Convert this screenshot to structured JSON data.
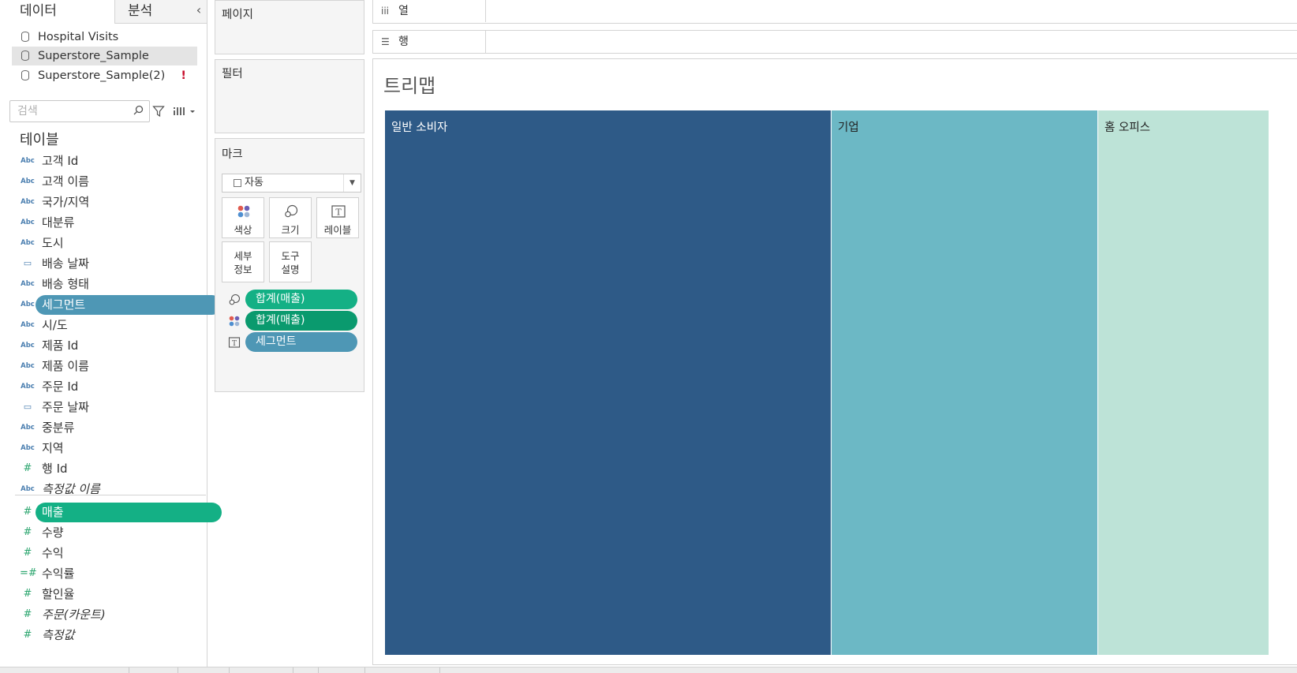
{
  "left_pane": {
    "tabs": {
      "data": "데이터",
      "analysis": "분석"
    },
    "collapse_icon": "chevron-left-icon",
    "data_sources": [
      {
        "name": "Hospital Visits",
        "selected": false,
        "warning": ""
      },
      {
        "name": "Superstore_Sample",
        "selected": true,
        "warning": ""
      },
      {
        "name": "Superstore_Sample(2)",
        "selected": false,
        "warning": "!"
      }
    ],
    "search": {
      "placeholder": "검색",
      "value": ""
    },
    "tables_header": "테이블",
    "fields": [
      {
        "type": "Abc",
        "kind": "dim",
        "label": "고객 Id"
      },
      {
        "type": "Abc",
        "kind": "dim",
        "label": "고객 이름"
      },
      {
        "type": "Abc",
        "kind": "dim",
        "label": "국가/지역"
      },
      {
        "type": "Abc",
        "kind": "dim",
        "label": "대분류"
      },
      {
        "type": "Abc",
        "kind": "dim",
        "label": "도시"
      },
      {
        "type": "date",
        "kind": "dim",
        "label": "배송 날짜"
      },
      {
        "type": "Abc",
        "kind": "dim",
        "label": "배송 형태"
      },
      {
        "type": "Abc",
        "kind": "dim",
        "label": "세그먼트",
        "pill": "dim"
      },
      {
        "type": "Abc",
        "kind": "dim",
        "label": "시/도"
      },
      {
        "type": "Abc",
        "kind": "dim",
        "label": "제품 Id"
      },
      {
        "type": "Abc",
        "kind": "dim",
        "label": "제품 이름"
      },
      {
        "type": "Abc",
        "kind": "dim",
        "label": "주문 Id"
      },
      {
        "type": "date",
        "kind": "dim",
        "label": "주문 날짜"
      },
      {
        "type": "Abc",
        "kind": "dim",
        "label": "중분류"
      },
      {
        "type": "Abc",
        "kind": "dim",
        "label": "지역"
      },
      {
        "type": "#",
        "kind": "dim",
        "label": "행 Id"
      },
      {
        "type": "Abc",
        "kind": "dim",
        "label": "측정값 이름",
        "italic": true
      },
      {
        "type": "#",
        "kind": "meas",
        "label": "매출",
        "pill": "meas"
      },
      {
        "type": "#",
        "kind": "meas",
        "label": "수량"
      },
      {
        "type": "#",
        "kind": "meas",
        "label": "수익"
      },
      {
        "type": "=#",
        "kind": "meas",
        "label": "수익률"
      },
      {
        "type": "#",
        "kind": "meas",
        "label": "할인율"
      },
      {
        "type": "#",
        "kind": "meas",
        "label": "주문(카운트)",
        "italic": true
      },
      {
        "type": "#",
        "kind": "meas",
        "label": "측정값",
        "italic": true
      }
    ]
  },
  "shelves": {
    "pages": "페이지",
    "filters": "필터",
    "marks": {
      "title": "마크",
      "mark_type": "자동",
      "buttons": [
        {
          "id": "color",
          "label": "색상",
          "icon": "color-dots-icon"
        },
        {
          "id": "size",
          "label": "크기",
          "icon": "size-icon"
        },
        {
          "id": "label",
          "label": "레이블",
          "icon": "text-label-icon"
        },
        {
          "id": "detail",
          "label": "세부\n정보",
          "icon": ""
        },
        {
          "id": "tooltip",
          "label": "도구\n설명",
          "icon": ""
        }
      ],
      "pills": [
        {
          "icon": "size-icon",
          "label": "합계(매출)",
          "style": "meas"
        },
        {
          "icon": "color-dots-icon",
          "label": "합계(매출)",
          "style": "meas-dark"
        },
        {
          "icon": "text-label-icon",
          "label": "세그먼트",
          "style": "dim"
        }
      ]
    }
  },
  "view": {
    "columns_label": "열",
    "rows_label": "행",
    "title": "트리맵"
  },
  "chart_data": {
    "type": "treemap",
    "title": "트리맵",
    "categories": [
      "일반 소비자",
      "기업",
      "홈 오피스"
    ],
    "values": [
      0.505,
      0.302,
      0.193
    ],
    "colors": [
      "#2e5a87",
      "#6cb8c5",
      "#bde3d7"
    ],
    "label_colors": [
      "#ffffff",
      "#222222",
      "#222222"
    ]
  }
}
